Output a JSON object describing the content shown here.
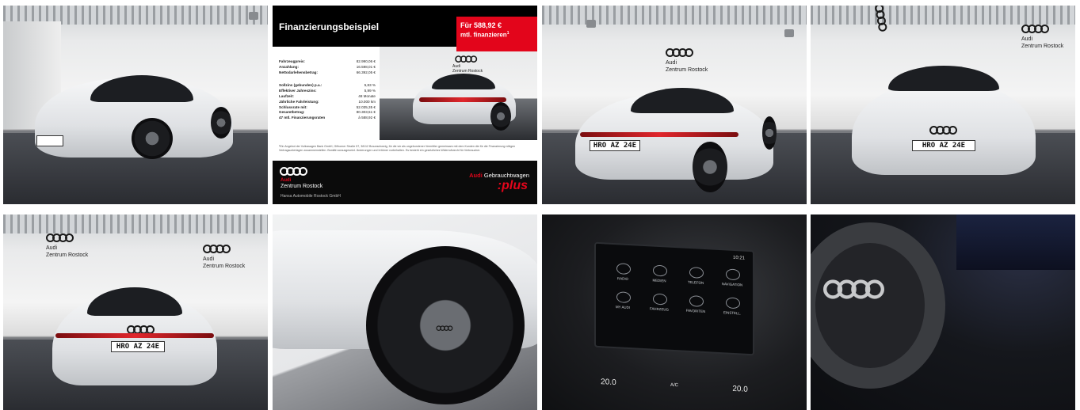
{
  "gallery": {
    "brand": {
      "logo_icon": "audi-four-rings",
      "name": "Audi",
      "dealer": "Zentrum Rostock"
    },
    "plate_text": "HRO AZ 24E",
    "financing": {
      "title": "Finanzierungsbeispiel",
      "price_line1": "Für 588,92 €",
      "price_line2": "mtl. finanzieren",
      "price_sup": "1",
      "rows_a": [
        {
          "label": "Fahrzeugpreis:",
          "value": "82.990,06 €"
        },
        {
          "label": "Anzahlung:",
          "value": "16.598,01 €"
        },
        {
          "label": "Nettodarlehensbetrag:",
          "value": "66.392,05 €"
        }
      ],
      "rows_b": [
        {
          "label": "Sollzins (gebunden) p.a.:",
          "value": "5,83 %"
        },
        {
          "label": "Effektiver Jahreszins:",
          "value": "5,99 %"
        },
        {
          "label": "Laufzeit:",
          "value": "48 Monate"
        },
        {
          "label": "Jährliche Fahrleistung:",
          "value": "10.000 km"
        },
        {
          "label": "Schlussrate mit:",
          "value": "52.035,35 €"
        },
        {
          "label": "Gesamtbetrag:",
          "value": "80.303,51 €"
        },
        {
          "label": "47 mtl. Finanzierungsraten",
          "value": "à 588,92 €"
        }
      ],
      "footnote": "¹Ein Angebot der Volkswagen Bank GmbH, Gifhorner Straße 57, 38112 Braunschweig, für die wir als ungebundener Vermittler gemeinsam mit dem Kunden die für die Finanzierung nötigen Vertragsunterlagen zusammenstellen. Bonität vorausgesetzt. Änderungen und Irrtümer vorbehalten. Es besteht ein gesetzliches Widerrufsrecht für Verbraucher.",
      "footer": {
        "audi": "Audi",
        "zentrum": "Zentrum Rostock",
        "company": "Hansa Automobile Rostock GmbH",
        "gw_audi": "Audi",
        "gw_label": "Gebrauchtwagen",
        "plus": ":plus"
      }
    },
    "infotainment": {
      "status": "10:21",
      "menu": [
        {
          "label": "RADIO",
          "icon": "radio-icon"
        },
        {
          "label": "MEDIEN",
          "icon": "music-icon"
        },
        {
          "label": "TELEFON",
          "icon": "phone-icon"
        },
        {
          "label": "NAVIGATION",
          "icon": "navigation-icon"
        },
        {
          "label": "MY AUDI",
          "icon": "user-icon"
        },
        {
          "label": "FAHRZEUG",
          "icon": "car-icon"
        },
        {
          "label": "FAVORITEN",
          "icon": "star-icon"
        },
        {
          "label": "EINSTELL.",
          "icon": "gear-icon"
        }
      ],
      "climate_left": "20.0",
      "climate_right": "20.0",
      "ac_label": "A/C"
    }
  }
}
